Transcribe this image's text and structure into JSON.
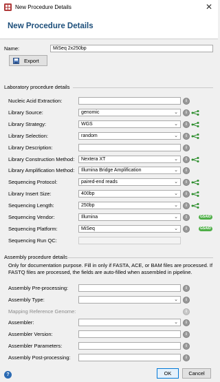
{
  "window": {
    "title": "New Procedure Details",
    "close_glyph": "✕"
  },
  "header": {
    "title": "New Procedure Details"
  },
  "name_row": {
    "label": "Name:",
    "value": "MiSeq 2x250bp"
  },
  "export_button": "Export",
  "lab_section": {
    "title": "Laboratory procedure details",
    "rows": [
      {
        "label": "Nucleic Acid Extraction:",
        "value": ""
      },
      {
        "label": "Library Source:",
        "value": "genomic"
      },
      {
        "label": "Library Strategy:",
        "value": "WGS"
      },
      {
        "label": "Library Selection:",
        "value": "random"
      },
      {
        "label": "Library Description:",
        "value": ""
      },
      {
        "label": "Library Construction Method:",
        "value": "Nextera XT"
      },
      {
        "label": "Library Amplification Method:",
        "value": "Illumina Bridge Amplification"
      },
      {
        "label": "Sequencing Protocol:",
        "value": "paired-end reads"
      },
      {
        "label": "Library Insert Size:",
        "value": "400bp"
      },
      {
        "label": "Sequencing Length:",
        "value": "250bp"
      },
      {
        "label": "Sequencing Vendor:",
        "value": "Illumina",
        "badge": "GSAID"
      },
      {
        "label": "Sequencing Platform:",
        "value": "MiSeq",
        "badge": "GSAID"
      },
      {
        "label": "Sequencing Run QC:",
        "value": ""
      }
    ]
  },
  "assembly_section": {
    "title": "Assembly procedure details",
    "note": "Only for documentation purpose. Fill in only if FASTA, ACE, or BAM files are processed. If FASTQ files are processed, the fields are auto-filled when assembled in pipeline.",
    "rows": [
      {
        "label": "Assembly Pre-processing:",
        "value": ""
      },
      {
        "label": "Assembly Type:",
        "value": ""
      },
      {
        "label": "Mapping Reference Genome:",
        "value": ""
      },
      {
        "label": "Assembler:",
        "value": ""
      },
      {
        "label": "Assembler Version:",
        "value": ""
      },
      {
        "label": "Assembler Parameters:",
        "value": ""
      },
      {
        "label": "Assembly Post-processing:",
        "value": ""
      }
    ]
  },
  "footer": {
    "ok": "OK",
    "cancel": "Cancel",
    "help_glyph": "?"
  },
  "colors": {
    "accent": "#1c4e7a",
    "badge": "#4fae48",
    "share_arrow": "#2f8f2f"
  }
}
